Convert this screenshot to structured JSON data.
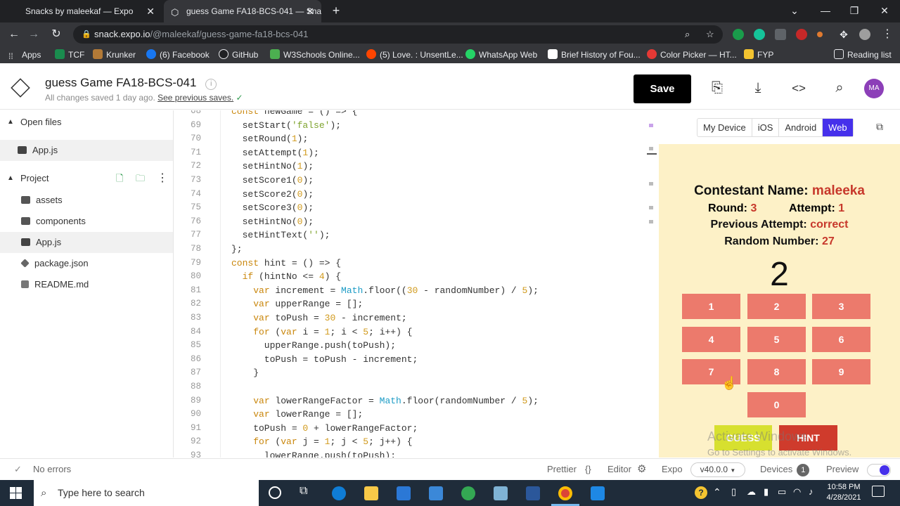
{
  "browser": {
    "tabs": [
      {
        "title": "Snacks by maleekaf — Expo"
      },
      {
        "title": "guess Game FA18-BCS-041 — Sna"
      }
    ],
    "url_host": "snack.expo.io",
    "url_path": "/@maleekaf/guess-game-fa18-bcs-041",
    "bookmarks": [
      {
        "label": "Apps",
        "color": "#e8eaed"
      },
      {
        "label": "TCF",
        "color": "#1a8c4e"
      },
      {
        "label": "Krunker",
        "color": "#b37a37"
      },
      {
        "label": "(6) Facebook",
        "color": "#1877f2"
      },
      {
        "label": "GitHub",
        "color": "#e8eaed"
      },
      {
        "label": "W3Schools Online...",
        "color": "#4caf50"
      },
      {
        "label": "(5) Love. : UnsentLe...",
        "color": "#ff4500"
      },
      {
        "label": "WhatsApp Web",
        "color": "#25d366"
      },
      {
        "label": "Brief History of Fou...",
        "color": "#ffffff"
      },
      {
        "label": "Color Picker — HT...",
        "color": "#e53935"
      },
      {
        "label": "FYP",
        "color": "#f4c430"
      }
    ],
    "reading_list": "Reading list"
  },
  "header": {
    "title": "guess Game FA18-BCS-041",
    "status": "All changes saved 1 day ago.",
    "previous_saves": "See previous saves.",
    "save_label": "Save",
    "avatar": "MA"
  },
  "sidebar": {
    "open_files_label": "Open files",
    "open_files": [
      "App.js"
    ],
    "project_label": "Project",
    "project_items": [
      {
        "name": "assets",
        "icon": "folder-icon"
      },
      {
        "name": "components",
        "icon": "folder-icon"
      },
      {
        "name": "App.js",
        "icon": "js-file-icon"
      },
      {
        "name": "package.json",
        "icon": "package-icon"
      },
      {
        "name": "README.md",
        "icon": "markdown-icon"
      }
    ]
  },
  "editor": {
    "lines": [
      {
        "n": "68",
        "html": "const newGame = () => {"
      },
      {
        "n": "69",
        "html": "  setStart('false');"
      },
      {
        "n": "70",
        "html": "  setRound(1);"
      },
      {
        "n": "71",
        "html": "  setAttempt(1);"
      },
      {
        "n": "72",
        "html": "  setHintNo(1);"
      },
      {
        "n": "73",
        "html": "  setScore1(0);"
      },
      {
        "n": "74",
        "html": "  setScore2(0);"
      },
      {
        "n": "75",
        "html": "  setScore3(0);"
      },
      {
        "n": "76",
        "html": "  setHintNo(0);"
      },
      {
        "n": "77",
        "html": "  setHintText('');"
      },
      {
        "n": "78",
        "html": "};"
      },
      {
        "n": "79",
        "html": "const hint = () => {"
      },
      {
        "n": "80",
        "html": "  if (hintNo <= 4) {"
      },
      {
        "n": "81",
        "html": "    var increment = Math.floor((30 - randomNumber) / 5);"
      },
      {
        "n": "82",
        "html": "    var upperRange = [];"
      },
      {
        "n": "83",
        "html": "    var toPush = 30 - increment;"
      },
      {
        "n": "84",
        "html": "    for (var i = 1; i < 5; i++) {"
      },
      {
        "n": "85",
        "html": "      upperRange.push(toPush);"
      },
      {
        "n": "86",
        "html": "      toPush = toPush - increment;"
      },
      {
        "n": "87",
        "html": "    }"
      },
      {
        "n": "88",
        "html": ""
      },
      {
        "n": "89",
        "html": "    var lowerRangeFactor = Math.floor(randomNumber / 5);"
      },
      {
        "n": "90",
        "html": "    var lowerRange = [];"
      },
      {
        "n": "91",
        "html": "    toPush = 0 + lowerRangeFactor;"
      },
      {
        "n": "92",
        "html": "    for (var j = 1; j < 5; j++) {"
      },
      {
        "n": "93",
        "html": "      lowerRange.push(toPush);"
      }
    ]
  },
  "preview": {
    "device_tabs": [
      "My Device",
      "iOS",
      "Android",
      "Web"
    ],
    "active_tab": "Web",
    "contestant_label": "Contestant Name:",
    "contestant_value": "maleeka",
    "round_label": "Round:",
    "round_value": "3",
    "attempt_label": "Attempt:",
    "attempt_value": "1",
    "prev_label": "Previous Attempt:",
    "prev_value": "correct",
    "random_label": "Random Number:",
    "random_value": "27",
    "shown_number": "2",
    "keys": [
      "1",
      "2",
      "3",
      "4",
      "5",
      "6",
      "7",
      "8",
      "9",
      "0"
    ],
    "guess_label": "GUESS",
    "hint_label": "HINT",
    "watermark_title": "Activate Windows",
    "watermark_sub": "Go to Settings to activate Windows."
  },
  "statusbar": {
    "errors": "No errors",
    "prettier": "Prettier",
    "editor": "Editor",
    "expo": "Expo",
    "sdk": "v40.0.0",
    "devices": "Devices",
    "device_count": "1",
    "preview": "Preview"
  },
  "taskbar": {
    "search_placeholder": "Type here to search",
    "time": "10:58 PM",
    "date": "4/28/2021"
  }
}
